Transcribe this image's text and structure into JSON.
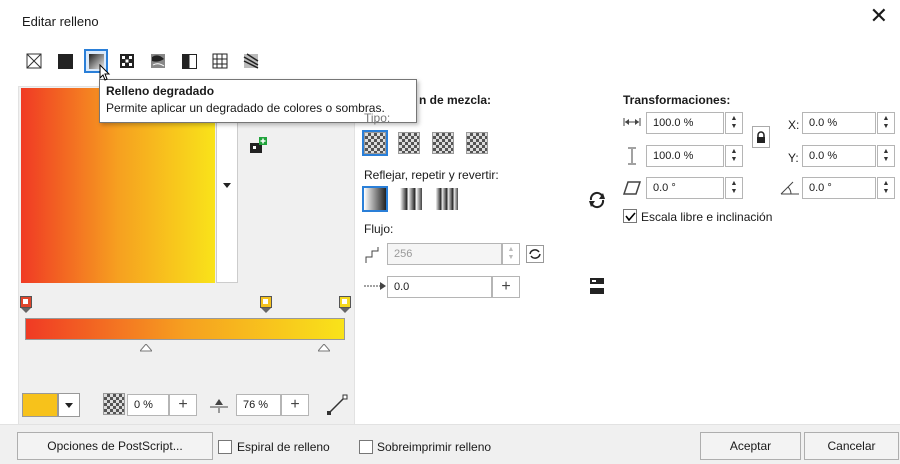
{
  "window": {
    "title": "Editar relleno",
    "close_glyph": "✕"
  },
  "toolbar": {
    "fill_types": [
      {
        "name": "no-fill-icon"
      },
      {
        "name": "uniform-fill-icon"
      },
      {
        "name": "gradient-fill-icon"
      },
      {
        "name": "vector-pattern-icon"
      },
      {
        "name": "bitmap-pattern-icon"
      },
      {
        "name": "two-color-pattern-icon"
      },
      {
        "name": "texture-fill-icon"
      },
      {
        "name": "postscript-fill-icon"
      }
    ]
  },
  "tooltip": {
    "title": "Relleno degradado",
    "description": "Permite aplicar un degradado de colores o sombras."
  },
  "gradient": {
    "start_color": "#f03a24",
    "end_color": "#f9e31a"
  },
  "blend": {
    "header": "n de mezcla:",
    "type_label": "Tipo:",
    "mirror_label": "Reflejar, repetir y revertir:",
    "flow_label": "Flujo:",
    "steps_value": "256",
    "accel_value": "0.0"
  },
  "transform": {
    "header": "Transformaciones:",
    "width_value": "100.0 %",
    "height_value": "100.0 %",
    "x_label": "X:",
    "x_value": "0.0 %",
    "y_label": "Y:",
    "y_value": "0.0 %",
    "skew_value": "0.0 °",
    "rotate_value": "0.0 °",
    "free_scale_label": "Escala libre e inclinación",
    "free_scale_checked": true
  },
  "node_controls": {
    "transparency_value": "0 %",
    "position_value": "76 %"
  },
  "footer": {
    "postscript_button": "Opciones de PostScript...",
    "spiral_label": "Espiral de relleno",
    "overprint_label": "Sobreimprimir relleno",
    "accept_button": "Aceptar",
    "cancel_button": "Cancelar"
  }
}
